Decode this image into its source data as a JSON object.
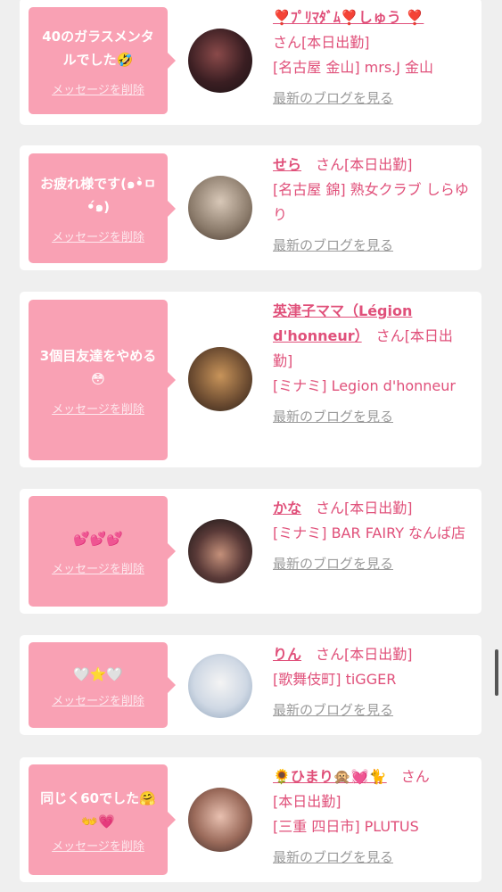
{
  "delete_label": "メッセージを削除",
  "blog_label": "最新のブログを見る",
  "san": "さん",
  "status": "[本日出勤]",
  "entries": [
    {
      "message": "40のガラスメンタルでした🤣",
      "name": "❣️ﾌﾟﾘﾏﾀﾞﾑ❣️しゅう ❣️",
      "shop": "[名古屋 金山] mrs.J 金山"
    },
    {
      "message": "お疲れ様です(๑•̀ㅁ•́๑)",
      "name": "せら",
      "shop": "[名古屋 錦] 熟女クラブ しらゆり"
    },
    {
      "message": "3個目友達をやめる😳",
      "name": "英津子ママ（Légion d'honneur）",
      "shop": "[ミナミ] Legion d'honneur"
    },
    {
      "message": "💕💕💕",
      "name": "かな",
      "shop": "[ミナミ] BAR FAIRY なんば店"
    },
    {
      "message": "🤍⭐️🤍",
      "name": "りん",
      "shop": "[歌舞伎町] tiGGER"
    },
    {
      "message": "同じく60でした🤗👐💗",
      "name": "🌻ひまり🙊💓🐈",
      "shop": "[三重 四日市] PLUTUS"
    }
  ],
  "colors": {
    "bubble": "#f9a1b4",
    "name": "#e0507a",
    "background": "#efefef"
  }
}
